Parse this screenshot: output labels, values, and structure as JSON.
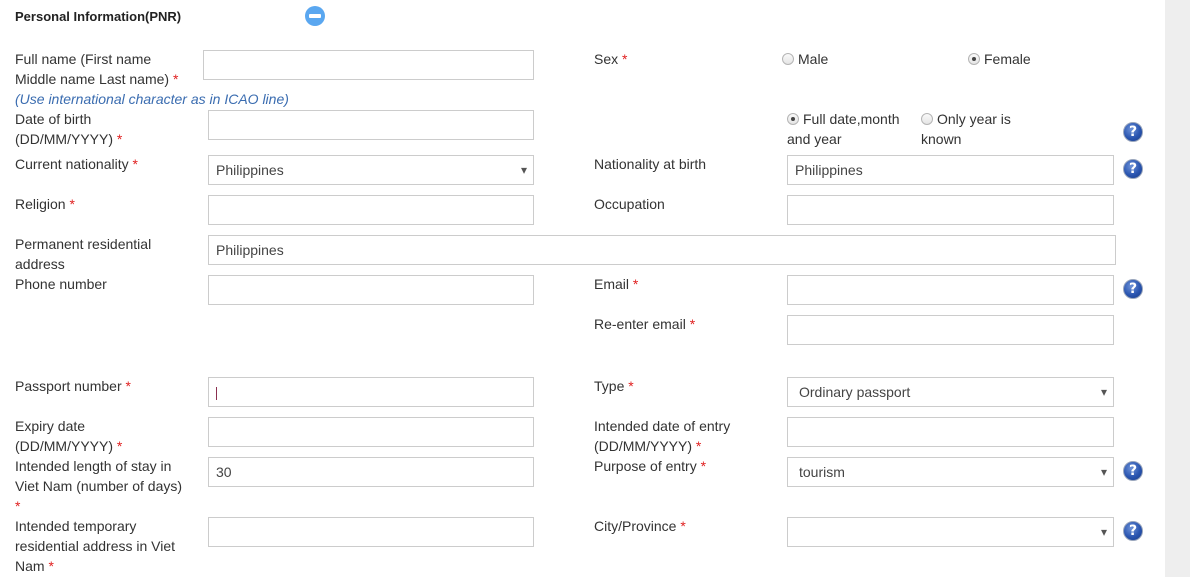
{
  "section": {
    "title": "Personal Information(PNR)",
    "collapse_icon": "minus-circle-icon"
  },
  "required_mark": "*",
  "help_icon_glyph": "?",
  "fields": {
    "full_name": {
      "label": "Full name (First name Middle name Last name)",
      "value": "",
      "hint": "(Use international character as in ICAO line)"
    },
    "sex": {
      "label": "Sex",
      "options": [
        {
          "label": "Male",
          "checked": false
        },
        {
          "label": "Female",
          "checked": true
        }
      ]
    },
    "dob": {
      "label": "Date of birth (DD/MM/YYYY)",
      "value": "",
      "options": [
        {
          "label": "Full date,month and year",
          "checked": true
        },
        {
          "label": "Only year is known",
          "checked": false
        }
      ]
    },
    "current_nationality": {
      "label": "Current nationality",
      "value": "Philippines"
    },
    "nationality_at_birth": {
      "label": "Nationality at birth",
      "value": "Philippines"
    },
    "religion": {
      "label": "Religion",
      "value": ""
    },
    "occupation": {
      "label": "Occupation",
      "value": ""
    },
    "permanent_address": {
      "label": "Permanent residential address",
      "value": "Philippines"
    },
    "phone": {
      "label": "Phone number",
      "value": ""
    },
    "email": {
      "label": "Email",
      "value": ""
    },
    "reenter_email": {
      "label": "Re-enter email",
      "value": ""
    },
    "passport_number": {
      "label": "Passport number",
      "value": ""
    },
    "passport_type": {
      "label": "Type",
      "value": "Ordinary passport"
    },
    "expiry_date": {
      "label": "Expiry date (DD/MM/YYYY)",
      "value": ""
    },
    "intended_entry_date": {
      "label": "Intended date of entry (DD/MM/YYYY)",
      "value": ""
    },
    "length_of_stay": {
      "label": "Intended length of stay in Viet Nam (number of days)",
      "value": "30"
    },
    "purpose_of_entry": {
      "label": "Purpose of entry",
      "value": "tourism"
    },
    "temp_address": {
      "label": "Intended temporary residential address in Viet Nam",
      "value": ""
    },
    "city_province": {
      "label": "City/Province",
      "value": ""
    }
  },
  "colors": {
    "accent": "#5aa7f0",
    "required": "#e02020",
    "hint": "#3a6cb0",
    "border": "#cccccc",
    "side_panel": "#eeeeee"
  }
}
